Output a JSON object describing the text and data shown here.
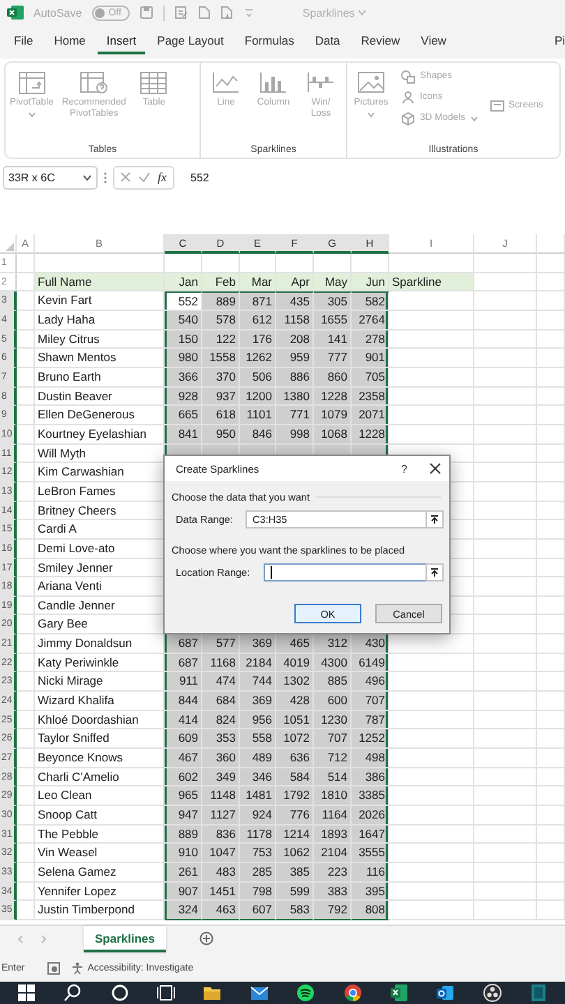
{
  "title_bar": {
    "autosave_label": "AutoSave",
    "autosave_state": "Off",
    "autosave_on": false,
    "document_title": "Sparklines"
  },
  "tabs": [
    {
      "label": "File",
      "selected": false
    },
    {
      "label": "Home",
      "selected": false
    },
    {
      "label": "Insert",
      "selected": true
    },
    {
      "label": "Page Layout",
      "selected": false
    },
    {
      "label": "Formulas",
      "selected": false
    },
    {
      "label": "Data",
      "selected": false
    },
    {
      "label": "Review",
      "selected": false
    },
    {
      "label": "View",
      "selected": false
    },
    {
      "label": "Pi",
      "selected": false
    }
  ],
  "ribbon": [
    {
      "title": "Tables",
      "commands": [
        {
          "label": "PivotTable",
          "kind": "large",
          "dropdown": true,
          "disabled": true
        },
        {
          "label": "Recommended PivotTables",
          "kind": "large",
          "dropdown": false,
          "disabled": true
        },
        {
          "label": "Table",
          "kind": "large",
          "dropdown": false,
          "disabled": true
        }
      ]
    },
    {
      "title": "Sparklines",
      "commands": [
        {
          "label": "Line",
          "kind": "large",
          "dropdown": false,
          "disabled": true
        },
        {
          "label": "Column",
          "kind": "large",
          "dropdown": false,
          "disabled": true
        },
        {
          "label": "Win/\nLoss",
          "kind": "large",
          "dropdown": false,
          "disabled": true
        }
      ]
    },
    {
      "title": "Illustrations",
      "commands": [
        {
          "label": "Pictures",
          "kind": "large",
          "dropdown": true,
          "disabled": true
        },
        {
          "label": "Shapes",
          "kind": "small",
          "dropdown": false,
          "disabled": true
        },
        {
          "label": "Icons",
          "kind": "small",
          "dropdown": false,
          "disabled": true
        },
        {
          "label": "3D Models",
          "kind": "small",
          "dropdown": true,
          "disabled": true
        },
        {
          "label": "Screens",
          "kind": "small",
          "dropdown": false,
          "disabled": true
        }
      ]
    }
  ],
  "formula_bar": {
    "name_box": "33R x 6C",
    "function_label": "fx",
    "value": "552"
  },
  "sheet": {
    "columns": [
      {
        "label": "A",
        "selected": false
      },
      {
        "label": "B",
        "selected": false
      },
      {
        "label": "C",
        "selected": true
      },
      {
        "label": "D",
        "selected": true
      },
      {
        "label": "E",
        "selected": true
      },
      {
        "label": "F",
        "selected": true
      },
      {
        "label": "G",
        "selected": true
      },
      {
        "label": "H",
        "selected": true
      },
      {
        "label": "I",
        "selected": false
      },
      {
        "label": "J",
        "selected": false
      }
    ],
    "rows": [
      {
        "number": "1",
        "kind": "blank",
        "selected": false
      },
      {
        "number": "2",
        "kind": "header",
        "selected": false,
        "name": "Full Name",
        "values": [
          "Jan",
          "Feb",
          "Mar",
          "Apr",
          "May",
          "Jun"
        ],
        "note": "Sparkline"
      },
      {
        "number": "3",
        "kind": "data",
        "selected": true,
        "active": true,
        "name": "Kevin Fart",
        "values": [
          "552",
          "889",
          "871",
          "435",
          "305",
          "582"
        ]
      },
      {
        "number": "4",
        "kind": "data",
        "selected": true,
        "name": "Lady Haha",
        "values": [
          "540",
          "578",
          "612",
          "1158",
          "1655",
          "2764"
        ]
      },
      {
        "number": "5",
        "kind": "data",
        "selected": true,
        "name": "Miley Citrus",
        "values": [
          "150",
          "122",
          "176",
          "208",
          "141",
          "278"
        ]
      },
      {
        "number": "6",
        "kind": "data",
        "selected": true,
        "name": "Shawn Mentos",
        "values": [
          "980",
          "1558",
          "1262",
          "959",
          "777",
          "901"
        ]
      },
      {
        "number": "7",
        "kind": "data",
        "selected": true,
        "name": "Bruno Earth",
        "values": [
          "366",
          "370",
          "506",
          "886",
          "860",
          "705"
        ]
      },
      {
        "number": "8",
        "kind": "data",
        "selected": true,
        "name": "Dustin Beaver",
        "values": [
          "928",
          "937",
          "1200",
          "1380",
          "1228",
          "2358"
        ]
      },
      {
        "number": "9",
        "kind": "data",
        "selected": true,
        "name": "Ellen DeGenerous",
        "values": [
          "665",
          "618",
          "1101",
          "771",
          "1079",
          "2071"
        ]
      },
      {
        "number": "10",
        "kind": "data",
        "selected": true,
        "name": "Kourtney Eyelashian",
        "values": [
          "841",
          "950",
          "846",
          "998",
          "1068",
          "1228"
        ]
      },
      {
        "number": "11",
        "kind": "data",
        "selected": true,
        "name": "Will Myth"
      },
      {
        "number": "12",
        "kind": "data",
        "selected": true,
        "name": "Kim Carwashian"
      },
      {
        "number": "13",
        "kind": "data",
        "selected": true,
        "name": "LeBron Fames"
      },
      {
        "number": "14",
        "kind": "data",
        "selected": true,
        "name": "Britney Cheers"
      },
      {
        "number": "15",
        "kind": "data",
        "selected": true,
        "name": "Cardi A"
      },
      {
        "number": "16",
        "kind": "data",
        "selected": true,
        "name": "Demi Love-ato"
      },
      {
        "number": "17",
        "kind": "data",
        "selected": true,
        "name": "Smiley Jenner"
      },
      {
        "number": "18",
        "kind": "data",
        "selected": true,
        "name": "Ariana Venti"
      },
      {
        "number": "19",
        "kind": "data",
        "selected": true,
        "name": "Candle Jenner"
      },
      {
        "number": "20",
        "kind": "data",
        "selected": true,
        "name": "Gary Bee"
      },
      {
        "number": "21",
        "kind": "data",
        "selected": true,
        "name": "Jimmy Donaldsun",
        "values": [
          "687",
          "577",
          "369",
          "465",
          "312",
          "430"
        ]
      },
      {
        "number": "22",
        "kind": "data",
        "selected": true,
        "name": "Katy Periwinkle",
        "values": [
          "687",
          "1168",
          "2184",
          "4019",
          "4300",
          "6149"
        ]
      },
      {
        "number": "23",
        "kind": "data",
        "selected": true,
        "name": "Nicki Mirage",
        "values": [
          "911",
          "474",
          "744",
          "1302",
          "885",
          "496"
        ]
      },
      {
        "number": "24",
        "kind": "data",
        "selected": true,
        "name": "Wizard Khalifa",
        "values": [
          "844",
          "684",
          "369",
          "428",
          "600",
          "707"
        ]
      },
      {
        "number": "25",
        "kind": "data",
        "selected": true,
        "name": "Khloé Doordashian",
        "values": [
          "414",
          "824",
          "956",
          "1051",
          "1230",
          "787"
        ]
      },
      {
        "number": "26",
        "kind": "data",
        "selected": true,
        "name": "Taylor Sniffed",
        "values": [
          "609",
          "353",
          "558",
          "1072",
          "707",
          "1252"
        ]
      },
      {
        "number": "27",
        "kind": "data",
        "selected": true,
        "name": "Beyonce Knows",
        "values": [
          "467",
          "360",
          "489",
          "636",
          "712",
          "498"
        ]
      },
      {
        "number": "28",
        "kind": "data",
        "selected": true,
        "name": "Charli C'Amelio",
        "values": [
          "602",
          "349",
          "346",
          "584",
          "514",
          "386"
        ]
      },
      {
        "number": "29",
        "kind": "data",
        "selected": true,
        "name": "Leo Clean",
        "values": [
          "965",
          "1148",
          "1481",
          "1792",
          "1810",
          "3385"
        ]
      },
      {
        "number": "30",
        "kind": "data",
        "selected": true,
        "name": "Snoop Catt",
        "values": [
          "947",
          "1127",
          "924",
          "776",
          "1164",
          "2026"
        ]
      },
      {
        "number": "31",
        "kind": "data",
        "selected": true,
        "name": "The Pebble",
        "values": [
          "889",
          "836",
          "1178",
          "1214",
          "1893",
          "1647"
        ]
      },
      {
        "number": "32",
        "kind": "data",
        "selected": true,
        "name": "Vin Weasel",
        "values": [
          "910",
          "1047",
          "753",
          "1062",
          "2104",
          "3555"
        ]
      },
      {
        "number": "33",
        "kind": "data",
        "selected": true,
        "name": "Selena Gamez",
        "values": [
          "261",
          "483",
          "285",
          "385",
          "223",
          "116"
        ]
      },
      {
        "number": "34",
        "kind": "data",
        "selected": true,
        "name": "Yennifer Lopez",
        "values": [
          "907",
          "1451",
          "798",
          "599",
          "383",
          "395"
        ]
      },
      {
        "number": "35",
        "kind": "data",
        "selected": true,
        "name": "Justin Timberpond",
        "values": [
          "324",
          "463",
          "607",
          "583",
          "792",
          "808"
        ]
      }
    ]
  },
  "dialog": {
    "title": "Create Sparklines",
    "help": "?",
    "data_section": "Choose the data that you want",
    "data_range": {
      "label": "Data Range:",
      "value": "C3:H35",
      "focused": false
    },
    "location_section": "Choose where you want the sparklines to be placed",
    "location_range": {
      "label": "Location Range:",
      "focused": true
    },
    "buttons": [
      {
        "label": "OK",
        "default": true
      },
      {
        "label": "Cancel",
        "default": false
      }
    ]
  },
  "sheet_tabs": [
    {
      "label": "Sparklines",
      "selected": true
    }
  ],
  "status_bar": {
    "mode": "Enter",
    "accessibility": "Accessibility: Investigate"
  }
}
